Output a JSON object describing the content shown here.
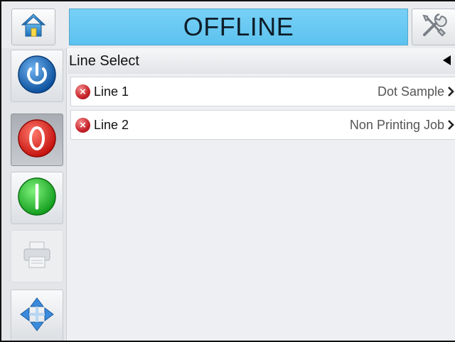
{
  "topbar": {
    "status": "OFFLINE",
    "home_icon": "home-icon",
    "tools_icon": "tools-icon",
    "status_color": "#5cc2ef"
  },
  "sidebar": {
    "items": [
      {
        "name": "power",
        "icon": "power-icon",
        "color": "#1c73c9"
      },
      {
        "name": "stop",
        "icon": "stop-icon",
        "color": "#e8231f"
      },
      {
        "name": "start",
        "icon": "start-icon",
        "color": "#1fbe2a"
      },
      {
        "name": "print",
        "icon": "printer-icon",
        "disabled": true
      },
      {
        "name": "navigate",
        "icon": "move-arrows-icon",
        "color": "#2f7fcf"
      }
    ]
  },
  "content": {
    "header": "Line Select",
    "lines": [
      {
        "name": "Line 1",
        "job": "Dot Sample",
        "status_icon": "error-icon"
      },
      {
        "name": "Line 2",
        "job": "Non Printing Job",
        "status_icon": "error-icon"
      }
    ]
  }
}
